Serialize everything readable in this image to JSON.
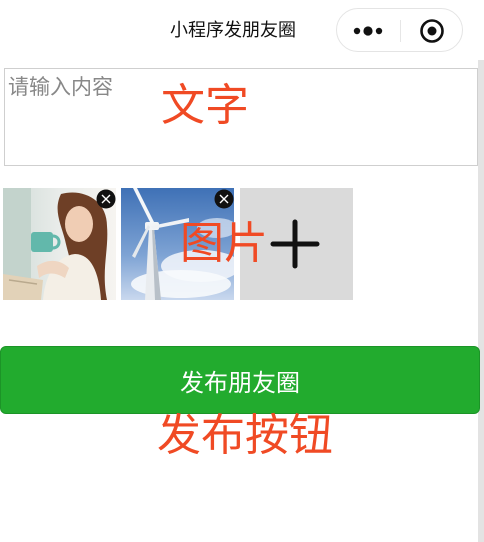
{
  "nav": {
    "title": "小程序发朋友圈",
    "more_icon": "more-dots-icon",
    "close_icon": "target-close-icon"
  },
  "composer": {
    "placeholder": "请输入内容",
    "value": ""
  },
  "images": [
    {
      "alt": "woman-reading-photo",
      "delete_icon": "delete-x-icon"
    },
    {
      "alt": "wind-turbine-photo",
      "delete_icon": "delete-x-icon"
    }
  ],
  "add_tile": {
    "icon": "plus-icon"
  },
  "publish": {
    "label": "发布朋友圈",
    "color": "#22ab2e"
  },
  "annotations": {
    "text_area": "文字",
    "images": "图片",
    "button": "发布按钮",
    "color": "#f04a24"
  }
}
